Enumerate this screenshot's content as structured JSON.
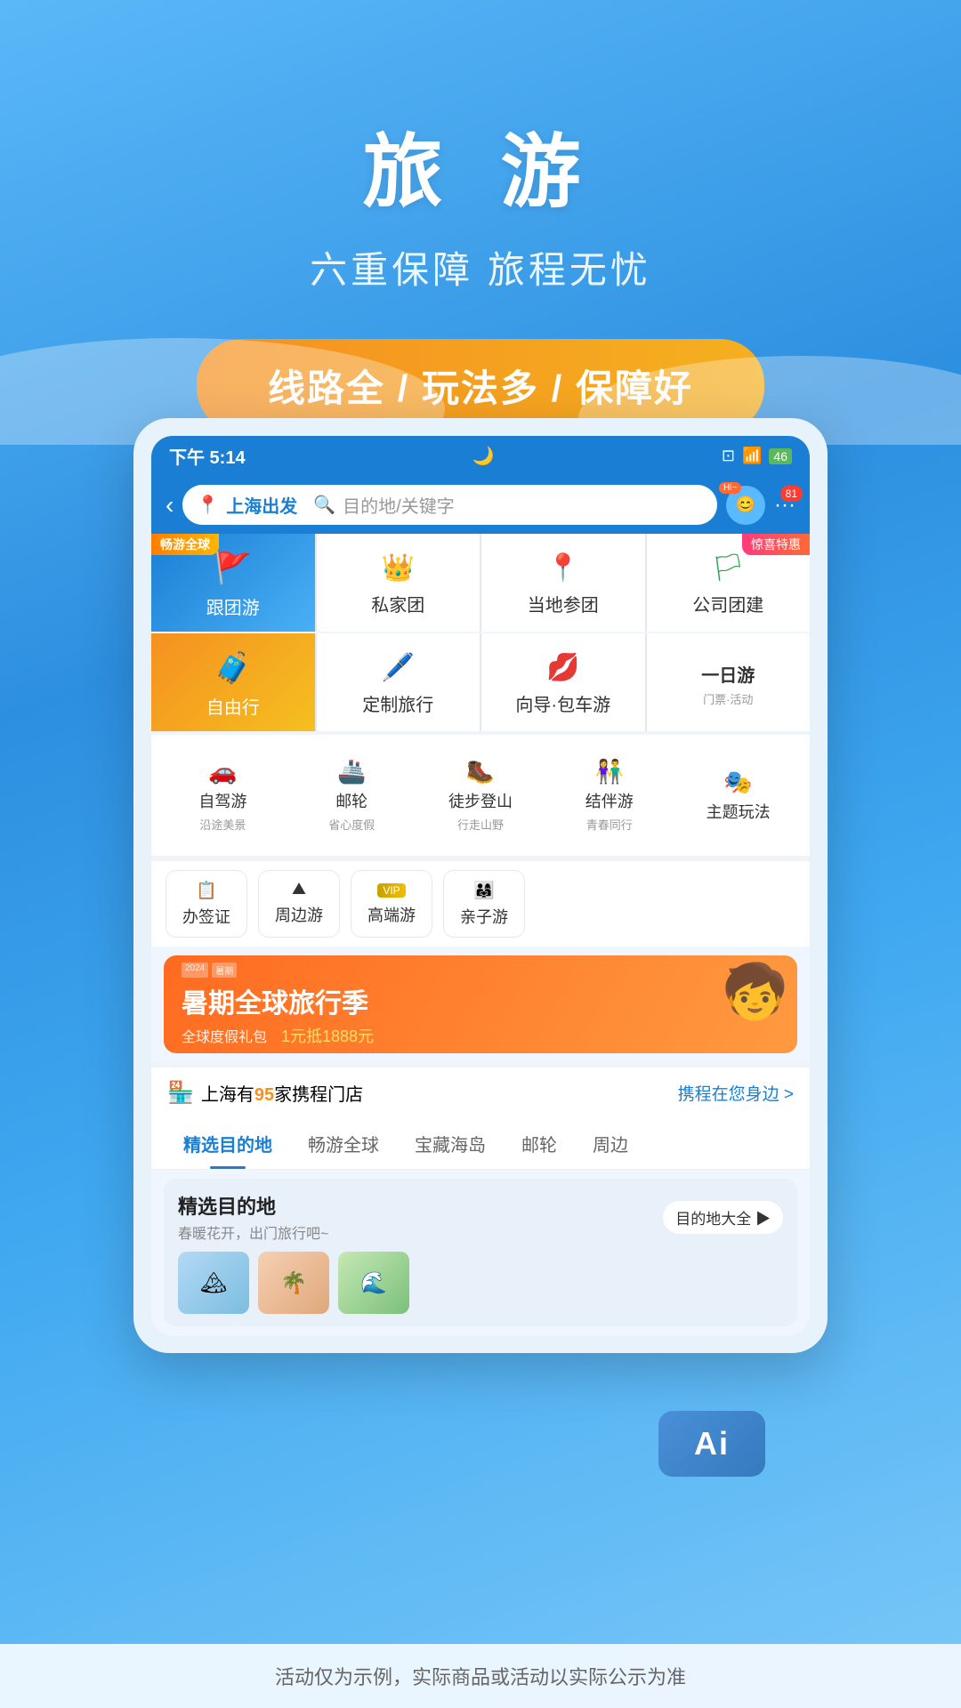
{
  "hero": {
    "title": "旅 游",
    "subtitle": "六重保障 旅程无忧",
    "badge": "线路全 / 玩法多 / 保障好"
  },
  "statusBar": {
    "time": "下午 5:14",
    "moonIcon": "🌙"
  },
  "navBar": {
    "origin": "上海出发",
    "searchPlaceholder": "目的地/关键字",
    "hiBadge": "Hi~",
    "notifBadge": "81"
  },
  "categories": [
    {
      "id": "group-tour",
      "label": "跟团游",
      "icon": "🚩",
      "badge": "畅游全球",
      "bgClass": "blue-bg"
    },
    {
      "id": "private-group",
      "label": "私家团",
      "icon": "👑",
      "bgClass": ""
    },
    {
      "id": "local-tour",
      "label": "当地参团",
      "icon": "📍",
      "bgClass": ""
    },
    {
      "id": "corp-build",
      "label": "公司团建",
      "icon": "🏳",
      "badge2": "惊喜特惠",
      "bgClass": ""
    },
    {
      "id": "free-travel",
      "label": "自由行",
      "icon": "🧳",
      "bgClass": "orange-bg"
    },
    {
      "id": "custom-travel",
      "label": "定制旅行",
      "icon": "🎨",
      "bgClass": ""
    },
    {
      "id": "guide-bus",
      "label": "向导·包车游",
      "icon": "👄",
      "bgClass": ""
    },
    {
      "id": "day-tour",
      "label": "一日游",
      "sub": "门票·活动",
      "bgClass": ""
    }
  ],
  "categories2": [
    {
      "id": "self-drive",
      "label": "自驾游",
      "sub": "沿途美景",
      "icon": "🚗"
    },
    {
      "id": "cruise",
      "label": "邮轮",
      "sub": "省心度假",
      "icon": "🚢"
    },
    {
      "id": "hiking",
      "label": "徒步登山",
      "sub": "行走山野",
      "icon": "🥾"
    },
    {
      "id": "companion",
      "label": "结伴游",
      "sub": "青春同行",
      "icon": "👥"
    },
    {
      "id": "theme",
      "label": "主题玩法",
      "icon": "🎭"
    }
  ],
  "tags": [
    {
      "id": "visa",
      "label": "办签证",
      "icon": "📋"
    },
    {
      "id": "nearby",
      "label": "周边游",
      "icon": "⛰"
    },
    {
      "id": "luxury",
      "label": "高端游",
      "vip": true,
      "icon": "💎"
    },
    {
      "id": "family",
      "label": "亲子游",
      "icon": "👨‍👩‍👧"
    }
  ],
  "banner": {
    "main": "暑期全球旅行季",
    "sub": "全球度假礼包",
    "promo": "1元抵1888元"
  },
  "storeInfo": {
    "prefix": "上海有",
    "count": "95",
    "suffix": "家携程门店",
    "link": "携程在您身边 >"
  },
  "tabs": [
    {
      "id": "featured",
      "label": "精选目的地",
      "active": true
    },
    {
      "id": "global",
      "label": "畅游全球",
      "active": false
    },
    {
      "id": "island",
      "label": "宝藏海岛",
      "active": false
    },
    {
      "id": "cruise",
      "label": "邮轮",
      "active": false
    },
    {
      "id": "nearby",
      "label": "周边",
      "active": false
    }
  ],
  "destSection": {
    "title": "精选目的地",
    "sub": "春暖花开，出门旅行吧~",
    "btnLabel": "目的地大全 ▶"
  },
  "disclaimer": "活动仅为示例，实际商品或活动以实际公示为准",
  "aiLabel": "Ai"
}
